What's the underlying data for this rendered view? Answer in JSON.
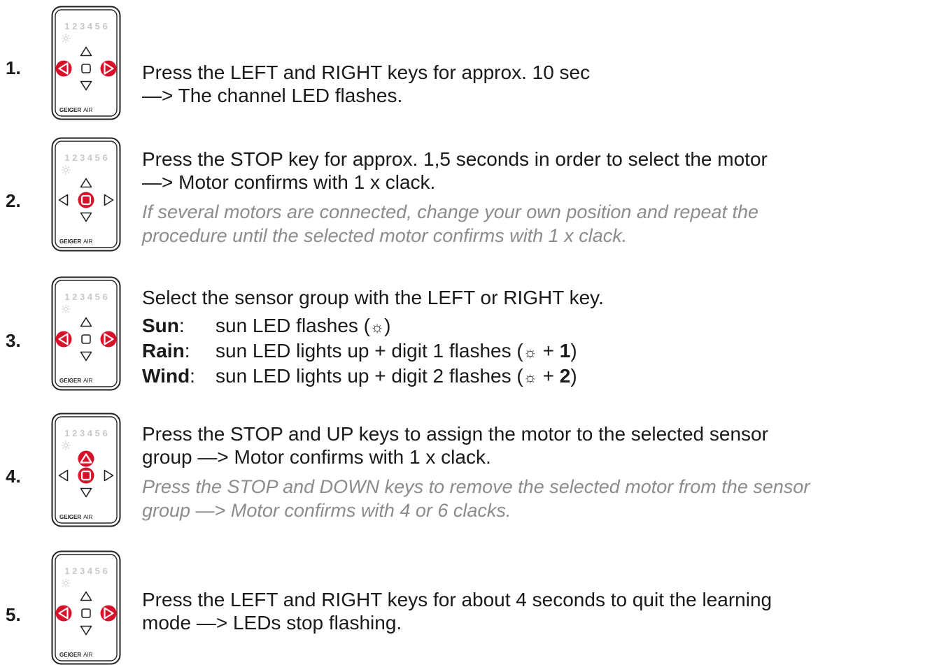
{
  "brand": {
    "name": "GEIGER",
    "suffix": "AIR",
    "channels": "1 2 3 4 5 6"
  },
  "colors": {
    "accent": "#d7112a",
    "text": "#1a1a1a",
    "note": "#8c8c8c"
  },
  "steps": [
    {
      "number": "1.",
      "pressed": [
        "left",
        "right"
      ],
      "lines": [
        "Press the LEFT and RIGHT keys for approx. 10 sec",
        "—> The channel LED flashes."
      ]
    },
    {
      "number": "2.",
      "pressed": [
        "stop"
      ],
      "lines": [
        "Press the STOP key for approx. 1,5 seconds in order to select the motor",
        "—> Motor confirms with 1 x clack."
      ],
      "note": [
        "If several motors are connected, change your own position and repeat the",
        "procedure until the selected motor confirms with 1 x clack."
      ]
    },
    {
      "number": "3.",
      "pressed": [
        "left",
        "right"
      ],
      "lines": [
        "Select the sensor group with the LEFT or RIGHT key."
      ],
      "groups": [
        {
          "label": "Sun",
          "colon": ":",
          "text": "sun LED flashes (",
          "sun": "☼",
          "plus": "",
          "digit": "",
          "end": ")"
        },
        {
          "label": "Rain",
          "colon": ":",
          "text": "sun LED lights up + digit 1 flashes (",
          "sun": "☼",
          "plus": " + ",
          "digit": "1",
          "end": ")"
        },
        {
          "label": "Wind",
          "colon": ":",
          "text": "sun LED lights up + digit 2 flashes (",
          "sun": "☼",
          "plus": " + ",
          "digit": "2",
          "end": ")"
        }
      ]
    },
    {
      "number": "4.",
      "pressed": [
        "up",
        "stop"
      ],
      "lines": [
        "Press the STOP and UP keys to assign the motor to the selected sensor",
        "group —> Motor confirms with 1 x clack."
      ],
      "note": [
        "Press the STOP and DOWN keys to remove the selected motor from the sensor",
        "group —> Motor confirms with 4 or 6 clacks."
      ]
    },
    {
      "number": "5.",
      "pressed": [
        "left",
        "right"
      ],
      "lines": [
        "Press the LEFT and RIGHT keys for about 4 seconds to quit the learning",
        "mode —> LEDs stop flashing."
      ]
    }
  ]
}
